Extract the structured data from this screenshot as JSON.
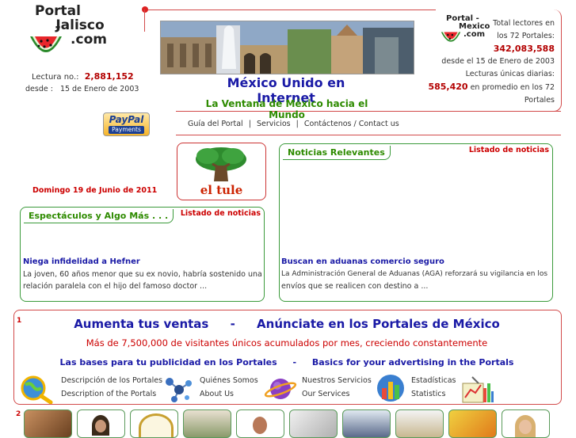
{
  "logo": {
    "line1": "Portal -",
    "line2": "Jalisco",
    "line3": ".com"
  },
  "reads": {
    "label": "Lectura no.:",
    "count": "2,881,152",
    "since_label": "desde :",
    "since_date": "15 de Enero de 2003"
  },
  "paypal": {
    "top": "PayPal",
    "bottom": "Payments"
  },
  "date": "Domingo 19 de Junio de 2011",
  "header": {
    "title": "México Unido en Internet",
    "subtitle": "La Ventana de México hacia el Mundo"
  },
  "nav": [
    "Guía del Portal",
    "Servicios",
    "Contáctenos / Contact us"
  ],
  "nav_sep": "|",
  "right_logo": {
    "line1": "Portal -",
    "line2": "Mexico",
    "line3": ".com"
  },
  "stats": {
    "total_label_1": "Total lectores en",
    "total_label_2": "los 72 Portales:",
    "total_value": "342,083,588",
    "since": "desde el 15 de Enero de 2003",
    "daily_label": "Lecturas únicas diarias:",
    "daily_value": "585,420",
    "daily_suffix": "en promedio en los 72",
    "daily_suffix2": "Portales"
  },
  "tule": {
    "label": "el tule"
  },
  "espectaculos": {
    "tab": "Espectáculos y Algo Más . . .",
    "link": "Listado de noticias",
    "item_title": "Niega infidelidad a Hefner",
    "item_text_1": "La joven, 60 años menor que su ex novio, habría sostenido una",
    "item_text_2": "relación paralela con el hijo del famoso doctor ..."
  },
  "noticias": {
    "tab": "Noticias Relevantes",
    "link": "Listado de noticias",
    "item_title": "Buscan en aduanas comercio seguro",
    "item_text_1": "La Administración General de Aduanas (AGA) reforzará su vigilancia en los",
    "item_text_2": "envíos que se realicen con destino a ..."
  },
  "ad": {
    "marker": "1",
    "headline_left": "Aumenta tus ventas",
    "headline_sep": "-",
    "headline_right": "Anúnciate en los Portales de México",
    "subline": "Más de 7,500,000 de visitantes únicos acumulados por mes, creciendo constantemente",
    "bases_es": "Las bases para tu publicidad en los Portales",
    "bases_sep": "-",
    "bases_en": "Basics for your advertising in the Portals"
  },
  "links": [
    {
      "es": "Descripción de los Portales",
      "en": "Description of the Portals",
      "icon": "magnifier-globe-icon"
    },
    {
      "es": "Quiénes Somos",
      "en": "About Us",
      "icon": "molecule-icon"
    },
    {
      "es": "Nuestros Servicios",
      "en": "Our Services",
      "icon": "planet-icon"
    },
    {
      "es": "Estadísticas",
      "en": "Statistics",
      "icon": "bar-chart-icon"
    }
  ],
  "bottom_marker": "2",
  "colors": {
    "accent_red": "#cc0000",
    "green": "#2e8b00",
    "blue": "#1a1aa6",
    "border_green": "#3a9a3a"
  }
}
